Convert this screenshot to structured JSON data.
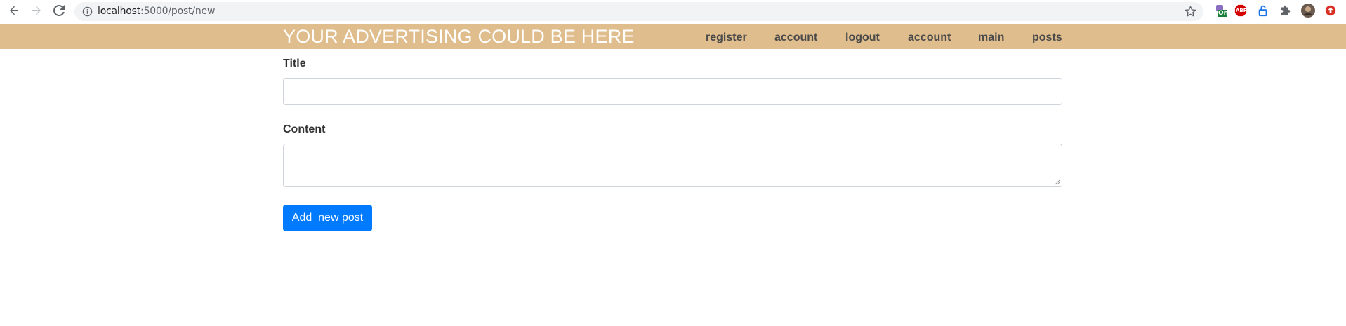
{
  "browser": {
    "url_host": "localhost",
    "url_path": ":5000/post/new",
    "extensions": [
      "on-badge-extension-icon",
      "adblock-icon",
      "lock-extension-icon",
      "puzzle-extensions-icon",
      "profile-avatar",
      "red-upload-icon"
    ],
    "on_badge": "On",
    "abp_badge": "ABP"
  },
  "site": {
    "brand": "YOUR ADVERTISING COULD BE HERE",
    "header_color": "#e0bd8d",
    "nav": [
      {
        "label": "register"
      },
      {
        "label": "account"
      },
      {
        "label": "logout"
      },
      {
        "label": "account"
      },
      {
        "label": "main"
      },
      {
        "label": "posts"
      }
    ]
  },
  "form": {
    "title_label": "Title",
    "title_value": "",
    "content_label": "Content",
    "content_value": "",
    "submit_label": "Add  new post",
    "submit_color": "#007bff"
  }
}
